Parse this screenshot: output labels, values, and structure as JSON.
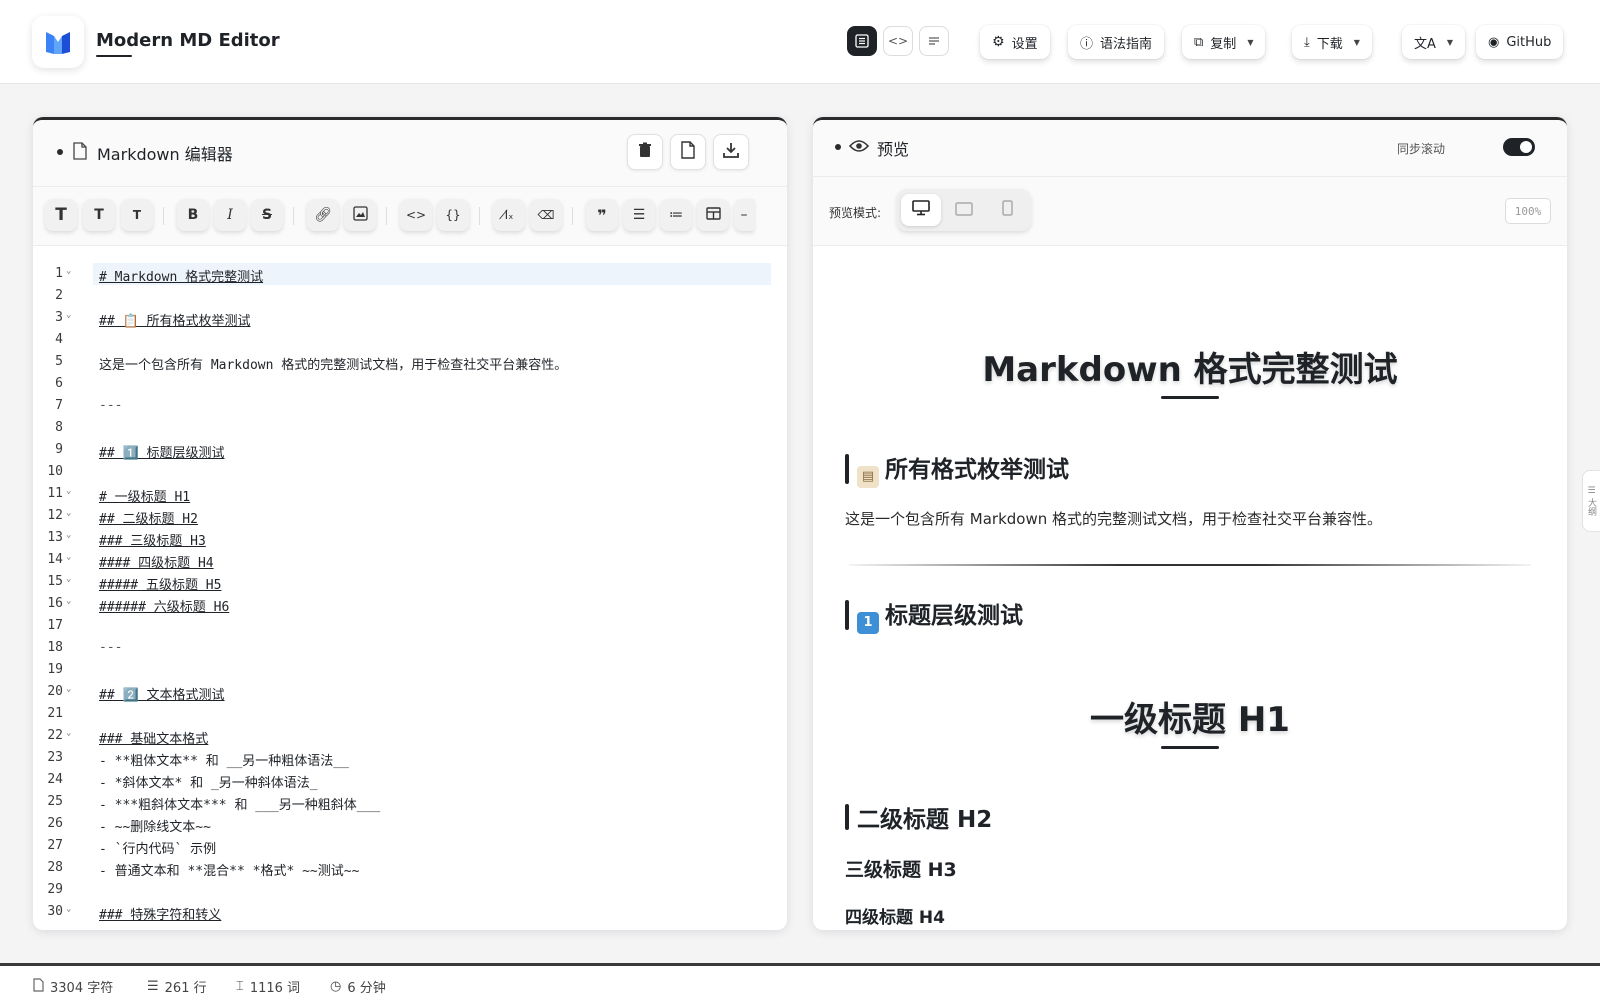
{
  "header": {
    "title": "Modern MD Editor",
    "buttons": {
      "settings": "设置",
      "syntax_guide": "语法指南",
      "copy": "复制",
      "download": "下载",
      "github": "GitHub"
    }
  },
  "editor": {
    "title": "Markdown 编辑器",
    "lines": [
      {
        "n": "1",
        "t": "# Markdown 格式完整测试",
        "fold": true,
        "u": true,
        "current": true
      },
      {
        "n": "2",
        "t": ""
      },
      {
        "n": "3",
        "t": "## 📋 所有格式枚举测试",
        "fold": true,
        "u": true
      },
      {
        "n": "4",
        "t": ""
      },
      {
        "n": "5",
        "t": "这是一个包含所有 Markdown 格式的完整测试文档，用于检查社交平台兼容性。"
      },
      {
        "n": "6",
        "t": ""
      },
      {
        "n": "7",
        "t": "---",
        "dim": true
      },
      {
        "n": "8",
        "t": ""
      },
      {
        "n": "9",
        "t": "## 1️⃣ 标题层级测试",
        "u": true
      },
      {
        "n": "10",
        "t": ""
      },
      {
        "n": "11",
        "t": "# 一级标题 H1",
        "fold": true,
        "u": true
      },
      {
        "n": "12",
        "t": "## 二级标题 H2",
        "fold": true,
        "u": true
      },
      {
        "n": "13",
        "t": "### 三级标题 H3",
        "fold": true,
        "u": true
      },
      {
        "n": "14",
        "t": "#### 四级标题 H4",
        "fold": true,
        "u": true
      },
      {
        "n": "15",
        "t": "##### 五级标题 H5",
        "fold": true,
        "u": true
      },
      {
        "n": "16",
        "t": "###### 六级标题 H6",
        "fold": true,
        "u": true
      },
      {
        "n": "17",
        "t": ""
      },
      {
        "n": "18",
        "t": "---",
        "dim": true
      },
      {
        "n": "19",
        "t": ""
      },
      {
        "n": "20",
        "t": "## 2️⃣ 文本格式测试",
        "fold": true,
        "u": true
      },
      {
        "n": "21",
        "t": ""
      },
      {
        "n": "22",
        "t": "### 基础文本格式",
        "fold": true,
        "u": true
      },
      {
        "n": "23",
        "t": "- **粗体文本** 和 __另一种粗体语法__"
      },
      {
        "n": "24",
        "t": "- *斜体文本* 和 _另一种斜体语法_"
      },
      {
        "n": "25",
        "t": "- ***粗斜体文本*** 和 ___另一种粗斜体___"
      },
      {
        "n": "26",
        "t": "- ~~删除线文本~~"
      },
      {
        "n": "27",
        "t": "- `行内代码` 示例"
      },
      {
        "n": "28",
        "t": "- 普通文本和 **混合** *格式* ~~测试~~"
      },
      {
        "n": "29",
        "t": ""
      },
      {
        "n": "30",
        "t": "### 特殊字符和转义",
        "fold": true,
        "u": true
      }
    ]
  },
  "preview": {
    "title": "预览",
    "sync_label": "同步滚动",
    "mode_label": "预览模式:",
    "zoom": "100%",
    "outline_label": "大纲",
    "h1_main": "Markdown 格式完整测试",
    "h2_all": "所有格式枚举测试",
    "intro": "这是一个包含所有 Markdown 格式的完整测试文档，用于检查社交平台兼容性。",
    "h2_levels": "标题层级测试",
    "h1_sample": "一级标题 H1",
    "h2_sample": "二级标题 H2",
    "h3_sample": "三级标题 H3",
    "h4_sample": "四级标题 H4"
  },
  "status": {
    "chars": "3304 字符",
    "lines": "261 行",
    "words": "1116 词",
    "time": "6 分钟"
  },
  "colors": {
    "accent_dark": "#1f2328",
    "logo_blue": "#3b82f6",
    "emoji_blue": "#3d8fd6"
  }
}
